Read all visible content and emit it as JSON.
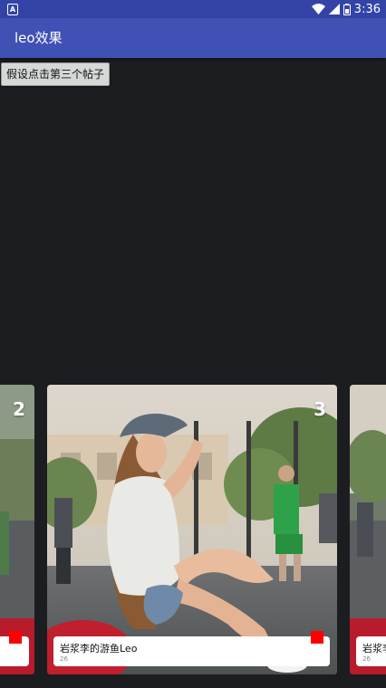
{
  "status_bar": {
    "notification_glyph": "A",
    "time": "3:36",
    "icons": [
      "wifi-icon",
      "signal-icon",
      "battery-icon"
    ]
  },
  "app_bar": {
    "title": "leo效果"
  },
  "action_button": {
    "label": "假设点击第三个帖子"
  },
  "colors": {
    "primary": "#3f51b5",
    "status_bar": "#3344a6",
    "background": "#1c1d21",
    "badge": "#ff0000"
  },
  "cards": [
    {
      "number": "2"
    },
    {
      "number": "3",
      "title": "岩浆李的游鱼Leo",
      "count": "26"
    },
    {
      "title": "岩浆李",
      "count": "26"
    }
  ]
}
